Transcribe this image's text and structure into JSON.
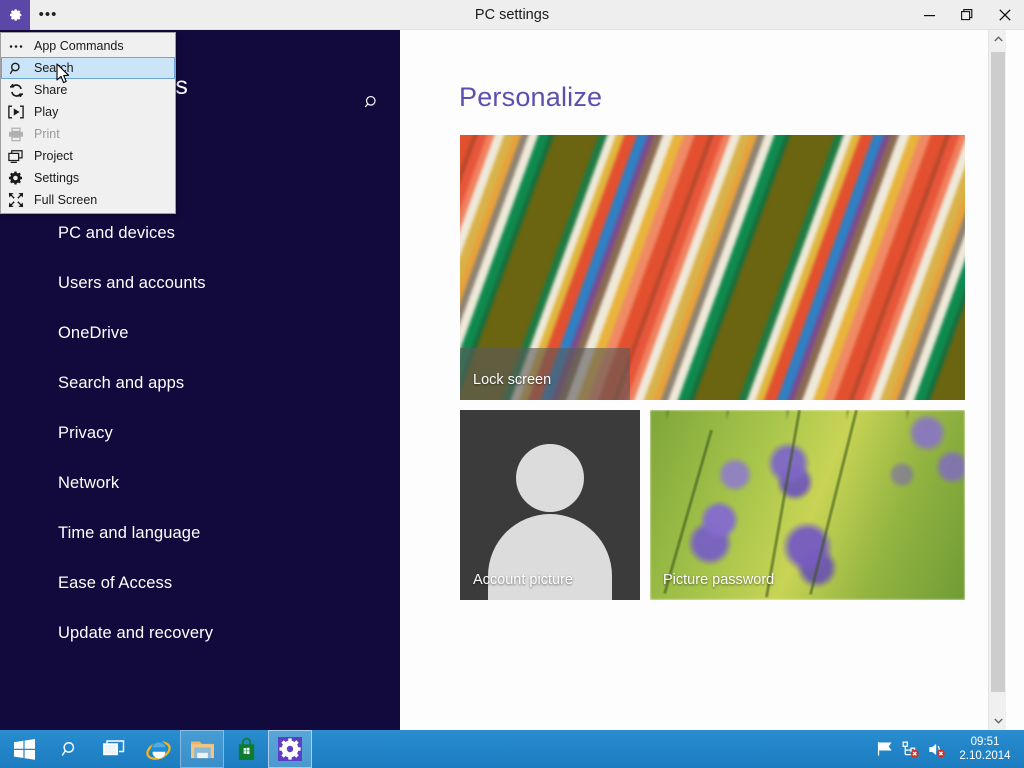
{
  "titlebar": {
    "app_icon": "gear-icon",
    "ellipsis_label": "•••",
    "title": "PC settings",
    "minimize_label": "–",
    "restore_label": "❑",
    "close_label": "✕"
  },
  "menu": {
    "items": [
      {
        "label": "App Commands",
        "icon": "ellipsis-icon",
        "state": "normal"
      },
      {
        "label": "Search",
        "icon": "search-icon",
        "state": "selected"
      },
      {
        "label": "Share",
        "icon": "share-icon",
        "state": "normal"
      },
      {
        "label": "Play",
        "icon": "play-icon",
        "state": "normal"
      },
      {
        "label": "Print",
        "icon": "printer-icon",
        "state": "disabled"
      },
      {
        "label": "Project",
        "icon": "project-icon",
        "state": "normal"
      },
      {
        "label": "Settings",
        "icon": "gear-icon",
        "state": "normal"
      },
      {
        "label": "Full Screen",
        "icon": "fullscreen-icon",
        "state": "normal"
      }
    ]
  },
  "sidebar": {
    "title": "PC settings",
    "search_icon": "search-icon",
    "background_color": "#12093d",
    "items": [
      {
        "label": "PC and devices"
      },
      {
        "label": "Users and accounts"
      },
      {
        "label": "OneDrive"
      },
      {
        "label": "Search and apps"
      },
      {
        "label": "Privacy"
      },
      {
        "label": "Network"
      },
      {
        "label": "Time and language"
      },
      {
        "label": "Ease of Access"
      },
      {
        "label": "Update and recovery"
      }
    ]
  },
  "content": {
    "page_title": "Personalize",
    "page_title_color": "#5b4fb0",
    "tiles": [
      {
        "label": "Lock screen",
        "art": "colorful-stripes"
      },
      {
        "label": "Account picture",
        "art": "person-silhouette"
      },
      {
        "label": "Picture password",
        "art": "lavender-field"
      }
    ]
  },
  "scrollbar": {
    "up_arrow": "chevron-up-icon",
    "down_arrow": "chevron-down-icon"
  },
  "taskbar": {
    "background_color": "#1b7cc0",
    "items": [
      {
        "name": "start-button",
        "icon": "windows-logo-icon",
        "state": "normal"
      },
      {
        "name": "search-button",
        "icon": "search-icon",
        "state": "normal"
      },
      {
        "name": "task-view-button",
        "icon": "task-view-icon",
        "state": "normal"
      },
      {
        "name": "internet-explorer",
        "icon": "ie-icon",
        "state": "normal"
      },
      {
        "name": "file-explorer",
        "icon": "folder-icon",
        "state": "running"
      },
      {
        "name": "store",
        "icon": "store-bag-icon",
        "state": "normal"
      },
      {
        "name": "pc-settings",
        "icon": "gear-icon",
        "state": "active"
      }
    ],
    "tray": [
      {
        "name": "action-center",
        "icon": "flag-icon"
      },
      {
        "name": "network",
        "icon": "network-error-icon"
      },
      {
        "name": "volume",
        "icon": "volume-muted-icon"
      }
    ],
    "clock": {
      "time": "09:51",
      "date": "2.10.2014"
    }
  }
}
